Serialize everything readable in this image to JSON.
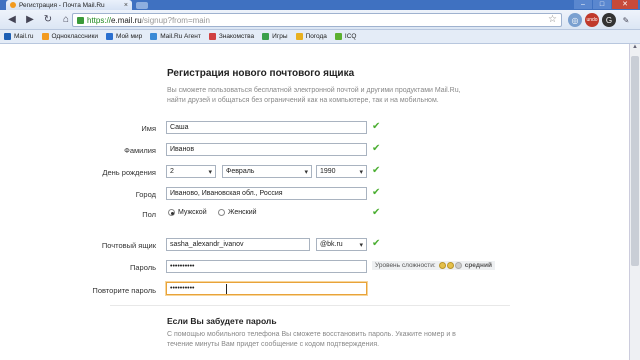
{
  "browser": {
    "tab_title": "Регистрация - Почта Mail.Ru",
    "tab_close": "×",
    "url_scheme": "https://",
    "url_host": "e.mail.ru",
    "url_path": "/signup?from=main",
    "min": "–",
    "max": "□",
    "close": "✕"
  },
  "bookmarks": [
    {
      "label": "Mail.ru",
      "color": "#1c5fb5"
    },
    {
      "label": "Одноклассники",
      "color": "#f29a1f"
    },
    {
      "label": "Мой мир",
      "color": "#2a6fcf"
    },
    {
      "label": "Mail.Ru Агент",
      "color": "#3a8ad6"
    },
    {
      "label": "Знакомства",
      "color": "#d04040"
    },
    {
      "label": "Игры",
      "color": "#3aa04a"
    },
    {
      "label": "Погода",
      "color": "#e8b020"
    },
    {
      "label": "ICQ",
      "color": "#5bb030"
    }
  ],
  "form": {
    "heading": "Регистрация нового почтового ящика",
    "intro": "Вы сможете пользоваться бесплатной электронной почтой и другими продуктами Mail.Ru, найти друзей и общаться без ограничений как на компьютере, так и на мобильном.",
    "first_name_label": "Имя",
    "first_name_value": "Саша",
    "last_name_label": "Фамилия",
    "last_name_value": "Иванов",
    "birthday_label": "День рождения",
    "birth_day": "2",
    "birth_month": "Февраль",
    "birth_year": "1990",
    "city_label": "Город",
    "city_value": "Иваново, Ивановская обл., Россия",
    "gender_label": "Пол",
    "gender_male": "Мужской",
    "gender_female": "Женский",
    "mailbox_label": "Почтовый ящик",
    "mailbox_value": "sasha_alexandr_ivanov",
    "domain_value": "@bk.ru",
    "password_label": "Пароль",
    "password_value": "••••••••••",
    "repeat_label": "Повторите пароль",
    "repeat_value": "••••••••••",
    "strength_label": "Уровень сложности:",
    "strength_level": "средний",
    "check": "✔",
    "arrow": "▾"
  },
  "recovery": {
    "heading": "Если Вы забудете пароль",
    "text": "С помощью мобильного телефона Вы сможете восстановить пароль. Укажите номер и в течение минуты Вам придет сообщение с кодом подтверждения."
  }
}
